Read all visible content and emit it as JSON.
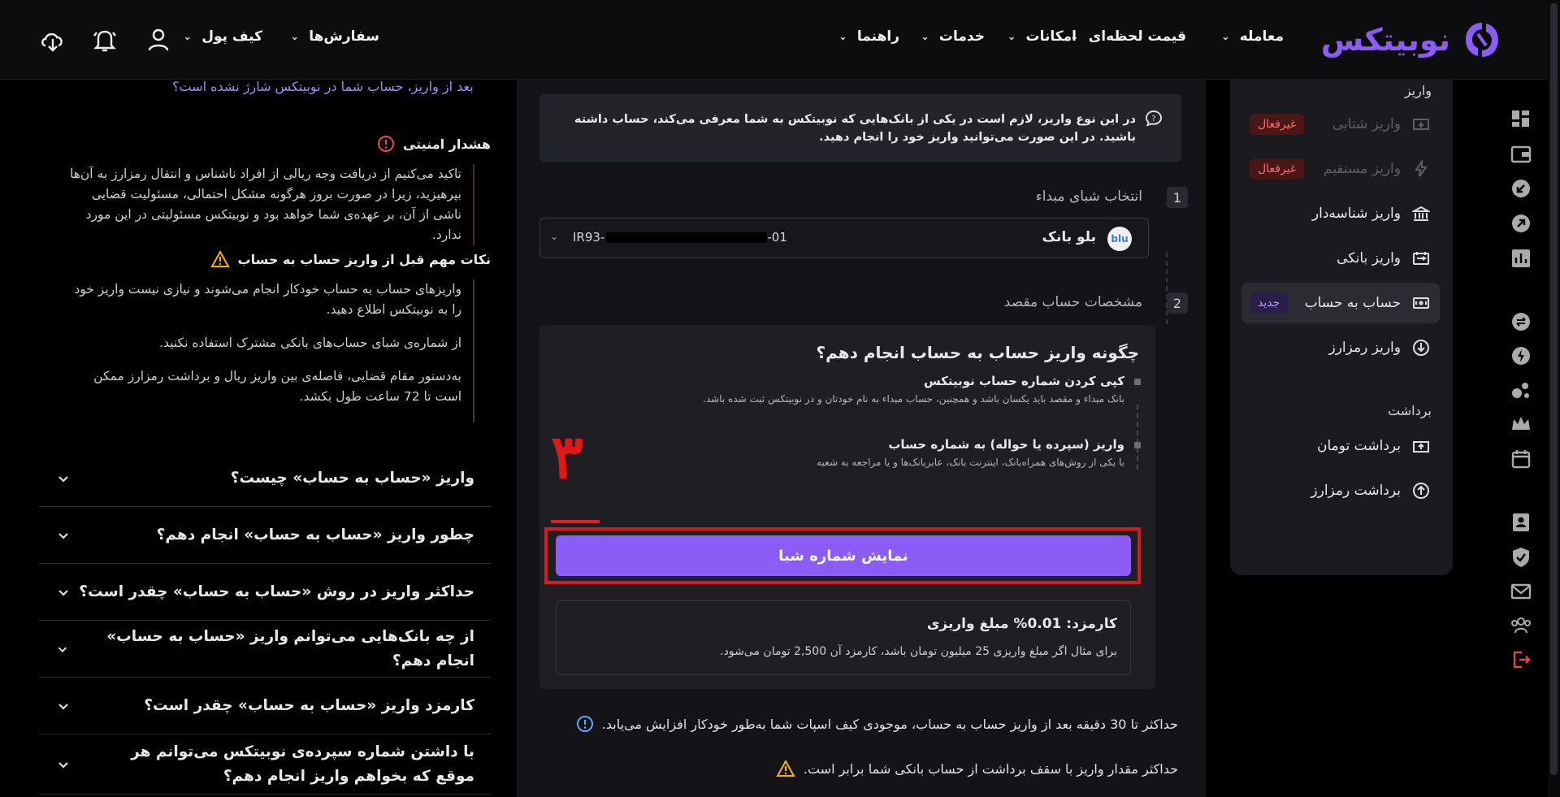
{
  "brand": {
    "name": "نوبیتکس",
    "color": "#8b5cf6"
  },
  "nav": [
    {
      "label": "معامله",
      "icon": "chevron-down-icon"
    },
    {
      "label": "قیمت لحظه‌ای",
      "icon": "chevron-down-icon"
    },
    {
      "label": "امکانات",
      "icon": "chevron-down-icon"
    },
    {
      "label": "خدمات",
      "icon": "chevron-down-icon"
    },
    {
      "label": "راهنما",
      "icon": "chevron-down-icon"
    }
  ],
  "user_nav": [
    {
      "label": "سفارش‌ها",
      "icon": "chevron-down-icon"
    },
    {
      "label": "کیف پول",
      "icon": "chevron-down-icon"
    }
  ],
  "sidebar": {
    "deposit_section": "واریز",
    "withdraw_section": "برداشت",
    "items": [
      {
        "label": "واریز شتابی",
        "badge": "غیرفعال",
        "state": "disabled",
        "icon": "instant-deposit-icon"
      },
      {
        "label": "واریز مستقیم",
        "badge": "غیرفعال",
        "state": "disabled",
        "icon": "lightning-icon"
      },
      {
        "label": "واریز شناسه‌دار",
        "badge": "",
        "state": "normal",
        "icon": "bank-icon"
      },
      {
        "label": "واریز بانکی",
        "badge": "",
        "state": "normal",
        "icon": "bank-transfer-icon"
      },
      {
        "label": "حساب به حساب",
        "badge": "جدید",
        "state": "active",
        "icon": "cash-icon"
      },
      {
        "label": "واریز رمزارز",
        "badge": "",
        "state": "normal",
        "icon": "crypto-deposit-icon"
      },
      {
        "label": "برداشت تومان",
        "badge": "",
        "state": "normal",
        "icon": "toman-withdraw-icon"
      },
      {
        "label": "برداشت رمزارز",
        "badge": "",
        "state": "normal",
        "icon": "crypto-withdraw-icon"
      }
    ]
  },
  "main": {
    "info": "در این نوع واریز، لازم است در یکی از بانک‌هایی که نوبیتکس به شما معرفی می‌کند، حساب داشته باشید. در این صورت می‌توانید واریز خود را انجام دهید.",
    "step1": {
      "num": "1",
      "label": "انتخاب شبای مبداء"
    },
    "step2": {
      "num": "2",
      "label": "مشخصات حساب مقصد"
    },
    "source": {
      "bank": "بلو بانک",
      "bank_logo": "blu",
      "iban_prefix": "IR93-",
      "iban_suffix": "-01"
    },
    "howto": {
      "title": "چگونه واریز حساب به حساب انجام دهم؟",
      "steps": [
        {
          "title": "کپی کردن شماره حساب نوبیتکس",
          "sub": "بانک مبداء و مقصد باید یکسان باشد و همچنین، حساب مبداء به نام خودتان و در نوبیتکس ثبت شده باشد."
        },
        {
          "title": "واریز (سپرده یا حواله) به شماره حساب",
          "sub": "با یکی از روش‌های همراه‌بانک، اینترنت بانک، عابربانک‌ها و یا مراجعه به شعبه"
        }
      ],
      "annotation": "۳",
      "button": "نمایش شماره شبا"
    },
    "fee": {
      "title": "کارمزد: 0.01% مبلغ واریزی",
      "sub": "برای مثال اگر مبلغ واریزی 25 میلیون تومان باشد، کارمزد آن 2,500 تومان می‌شود."
    },
    "notes": [
      {
        "text": "حداکثر تا 30 دقیقه بعد از واریز حساب به حساب، موجودی کیف اسپات شما به‌طور خودکار افزایش می‌یابد.",
        "icon": "info-icon",
        "color": "#60a5fa"
      },
      {
        "text": "حداکثر مقدار واریز با سقف برداشت از حساب بانکی شما برابر است.",
        "icon": "warning-icon",
        "color": "#f5b400"
      }
    ]
  },
  "faq": {
    "top_link": "بعد از واریز، حساب شما در نوبیتکس شارژ نشده است؟",
    "security": {
      "title": "هشدار امنیتی",
      "text": "تاکید می‌کنیم از دریافت وجه ریالی از افراد ناشناس و انتقال رمزارز به آن‌ها بپرهیزید، زیرا در صورت بروز هرگونه مشکل احتمالی، مسئولیت قضایی ناشی از آن، بر عهده‌ی شما خواهد بود و نوبیتکس مسئولیتی در این مورد ندارد."
    },
    "tips": {
      "title": "نکات مهم قبل از واریز حساب به حساب",
      "items": [
        "واریزهای حساب به حساب خودکار انجام می‌شوند و نیازی نیست واریز خود را به نوبیتکس اطلاع دهید.",
        "از شماره‌ی شبای حساب‌های بانکی مشترک استفاده نکنید.",
        "به‌دستور مقام قضایی، فاصله‌ی بین واریز ریال و برداشت رمزارز ممکن است تا 72 ساعت طول بکشد."
      ]
    },
    "questions": [
      "واریز «حساب به حساب» چیست؟",
      "چطور واریز «حساب به حساب» انجام دهم؟",
      "حداکثر واریز در روش «حساب به حساب» چقدر است؟",
      "از چه بانک‌هایی می‌توانم واریز «حساب به حساب» انجام دهم؟",
      "کارمزد واریز «حساب به حساب» چقدر است؟",
      "با داشتن شماره سپرده‌ی نوبیتکس می‌توانم هر موقع که بخواهم واریز انجام دهم؟"
    ]
  }
}
